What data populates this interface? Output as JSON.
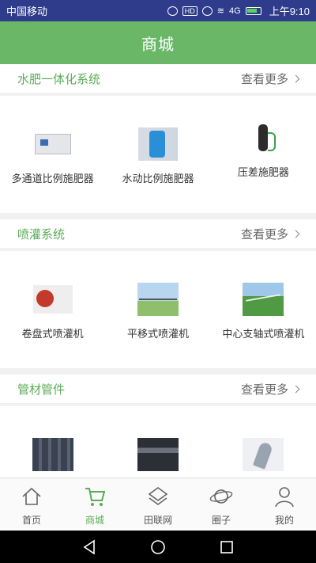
{
  "status_bar": {
    "carrier": "中国移动",
    "hd": "HD",
    "network": "4G",
    "time": "上午9:10"
  },
  "header": {
    "title": "商城"
  },
  "more_label": "查看更多",
  "sections": [
    {
      "title": "水肥一体化系统",
      "products": [
        {
          "name": "多通道比例施肥器",
          "image": "multi-channel-fertilizer-machine"
        },
        {
          "name": "水动比例施肥器",
          "image": "water-driven-fertilizer-injector"
        },
        {
          "name": "压差施肥器",
          "image": "pressure-differential-fertilizer-tank"
        }
      ]
    },
    {
      "title": "喷灌系统",
      "products": [
        {
          "name": "卷盘式喷灌机",
          "image": "hose-reel-irrigator"
        },
        {
          "name": "平移式喷灌机",
          "image": "linear-move-irrigator"
        },
        {
          "name": "中心支轴式喷灌机",
          "image": "center-pivot-irrigator"
        }
      ]
    },
    {
      "title": "管材管件",
      "products": [
        {
          "name": "",
          "image": "pipe-bundle"
        },
        {
          "name": "",
          "image": "black-pipe"
        },
        {
          "name": "",
          "image": "pipe-elbow"
        }
      ]
    }
  ],
  "tabs": [
    {
      "label": "首页",
      "icon": "home-icon",
      "active": false
    },
    {
      "label": "商城",
      "icon": "cart-icon",
      "active": true
    },
    {
      "label": "田联网",
      "icon": "network-icon",
      "active": false
    },
    {
      "label": "圈子",
      "icon": "planet-icon",
      "active": false
    },
    {
      "label": "我的",
      "icon": "user-icon",
      "active": false
    }
  ],
  "colors": {
    "status_bar": "#2f3c8c",
    "accent": "#5bac59",
    "header": "#6ab867"
  }
}
